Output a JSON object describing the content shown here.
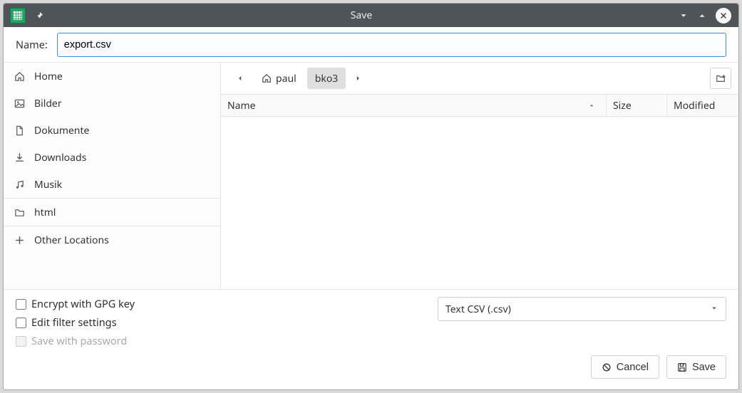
{
  "titlebar": {
    "title": "Save"
  },
  "name_row": {
    "label": "Name:",
    "value": "export.csv"
  },
  "sidebar": {
    "items": [
      {
        "icon": "home",
        "label": "Home"
      },
      {
        "icon": "image",
        "label": "Bilder"
      },
      {
        "icon": "doc",
        "label": "Dokumente"
      },
      {
        "icon": "down",
        "label": "Downloads"
      },
      {
        "icon": "music",
        "label": "Musik"
      }
    ],
    "mount": {
      "icon": "folder",
      "label": "html"
    },
    "other": {
      "icon": "plus",
      "label": "Other Locations"
    }
  },
  "path": {
    "crumbs": [
      {
        "key": "paul",
        "label": "paul",
        "home": true,
        "active": false
      },
      {
        "key": "bko3",
        "label": "bko3",
        "home": false,
        "active": true
      }
    ]
  },
  "columns": {
    "name": "Name",
    "size": "Size",
    "modified": "Modified"
  },
  "options": {
    "encrypt": {
      "label": "Encrypt with GPG key",
      "checked": false,
      "enabled": true
    },
    "filter": {
      "label": "Edit filter settings",
      "checked": false,
      "enabled": true
    },
    "pwsave": {
      "label": "Save with password",
      "checked": false,
      "enabled": false
    }
  },
  "filetype": {
    "selected": "Text CSV (.csv)"
  },
  "buttons": {
    "cancel": "Cancel",
    "save": "Save"
  }
}
